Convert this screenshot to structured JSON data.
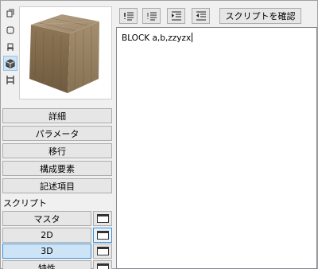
{
  "editor": {
    "text": "BLOCK a,b,zzyzx"
  },
  "toolbar": {
    "check_script_label": "スクリプトを確認"
  },
  "left_buttons": [
    {
      "label": "詳細"
    },
    {
      "label": "パラメータ"
    },
    {
      "label": "移行"
    },
    {
      "label": "構成要素"
    },
    {
      "label": "記述項目"
    }
  ],
  "scripts_section": {
    "label": "スクリプト",
    "items": [
      {
        "label": "マスタ"
      },
      {
        "label": "2D"
      },
      {
        "label": "3D"
      },
      {
        "label": "特性"
      }
    ]
  },
  "preview": {
    "material": "wood"
  },
  "view_modes": [
    "outline-icon",
    "shaded-icon",
    "chair-icon",
    "cube-icon",
    "section-icon"
  ],
  "colors": {
    "accent": "#3c8fd9",
    "active_fill": "#cde4f7"
  }
}
